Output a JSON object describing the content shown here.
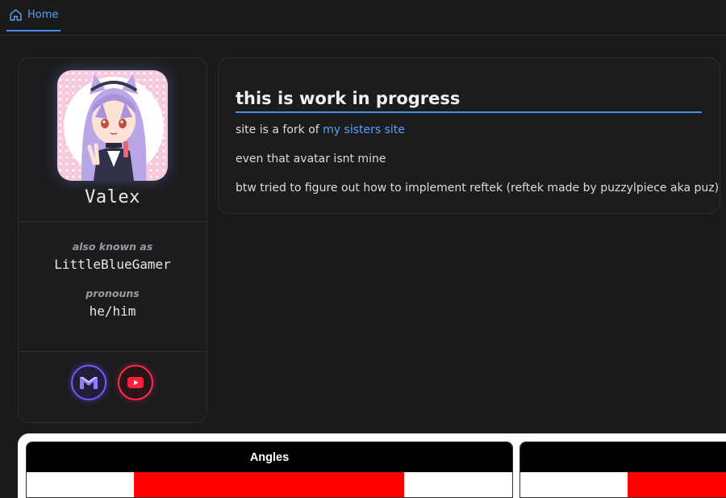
{
  "nav": {
    "home_label": "Home"
  },
  "profile": {
    "name": "Valex",
    "aka_label": "also known as",
    "aka_value": "LittleBlueGamer",
    "pronouns_label": "pronouns",
    "pronouns_value": "he/him"
  },
  "content": {
    "title": "this is work in progress",
    "line1_prefix": "site is a fork of ",
    "line1_link": "my sisters site",
    "line2": "even that avatar isnt mine",
    "line3": "btw tried to figure out how to implement reftek (reftek made by puzzylpiece aka puz)"
  },
  "widgets": {
    "angles_title": "Angles"
  },
  "colors": {
    "accent": "#4a8df0",
    "link": "#5aa0ff",
    "mail": "#6b5cff",
    "youtube": "#ff2c4f",
    "background": "#1a1a1b"
  },
  "icons": [
    "home-icon",
    "mail-icon",
    "youtube-icon"
  ]
}
